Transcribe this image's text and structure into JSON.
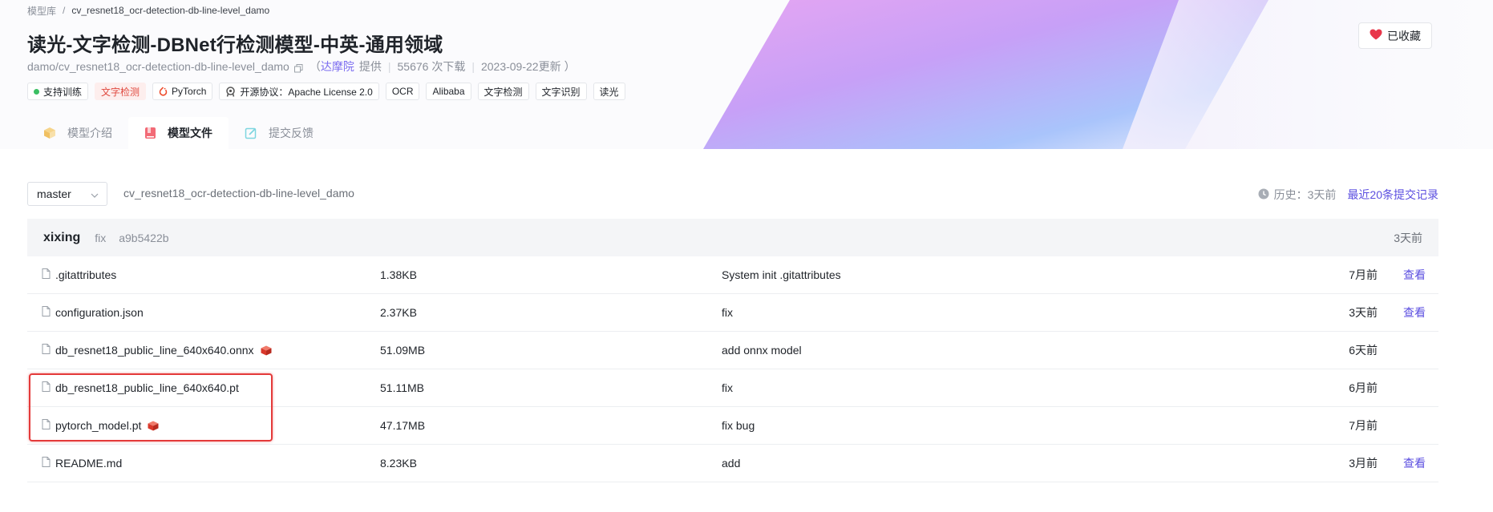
{
  "breadcrumb": {
    "root": "模型库",
    "separator": "/",
    "current": "cv_resnet18_ocr-detection-db-line-level_damo"
  },
  "title": "读光-文字检测-DBNet行检测模型-中英-通用领域",
  "meta": {
    "model_id": "damo/cv_resnet18_ocr-detection-db-line-level_damo",
    "open_paren": "（",
    "provider": "达摩院",
    "provider_suffix": "提供",
    "sep": "|",
    "downloads": "55676 次下载",
    "updated": "2023-09-22更新",
    "close_paren": "）"
  },
  "tags": {
    "train": "支持训练",
    "task": "文字检测",
    "framework": "PyTorch",
    "license": "开源协议：Apache License 2.0",
    "others": [
      "OCR",
      "Alibaba",
      "文字检测",
      "文字识别",
      "读光"
    ]
  },
  "favorite": {
    "label": "已收藏"
  },
  "tabs": [
    {
      "label": "模型介绍",
      "icon": "box-icon"
    },
    {
      "label": "模型文件",
      "icon": "book-icon"
    },
    {
      "label": "提交反馈",
      "icon": "edit-icon"
    }
  ],
  "branch": {
    "selected": "master"
  },
  "repo_path": "cv_resnet18_ocr-detection-db-line-level_damo",
  "history": {
    "label": "历史：3天前",
    "link": "最近20条提交记录"
  },
  "latest_commit": {
    "author": "xixing",
    "message": "fix",
    "hash": "a9b5422b",
    "time": "3天前"
  },
  "files": [
    {
      "name": ".gitattributes",
      "size": "1.38KB",
      "message": "System init .gitattributes",
      "time": "7月前",
      "view": "查看",
      "lfs": false
    },
    {
      "name": "configuration.json",
      "size": "2.37KB",
      "message": "fix",
      "time": "3天前",
      "view": "查看",
      "lfs": false
    },
    {
      "name": "db_resnet18_public_line_640x640.onnx",
      "size": "51.09MB",
      "message": "add onnx model",
      "time": "6天前",
      "view": "",
      "lfs": true
    },
    {
      "name": "db_resnet18_public_line_640x640.pt",
      "size": "51.11MB",
      "message": "fix",
      "time": "6月前",
      "view": "",
      "lfs": false
    },
    {
      "name": "pytorch_model.pt",
      "size": "47.17MB",
      "message": "fix bug",
      "time": "7月前",
      "view": "",
      "lfs": true
    },
    {
      "name": "README.md",
      "size": "8.23KB",
      "message": "add",
      "time": "3月前",
      "view": "查看",
      "lfs": false
    }
  ],
  "colors": {
    "accent": "#5b4ee0",
    "highlight": "#e43a3a",
    "tag_red": "#e0493f"
  }
}
